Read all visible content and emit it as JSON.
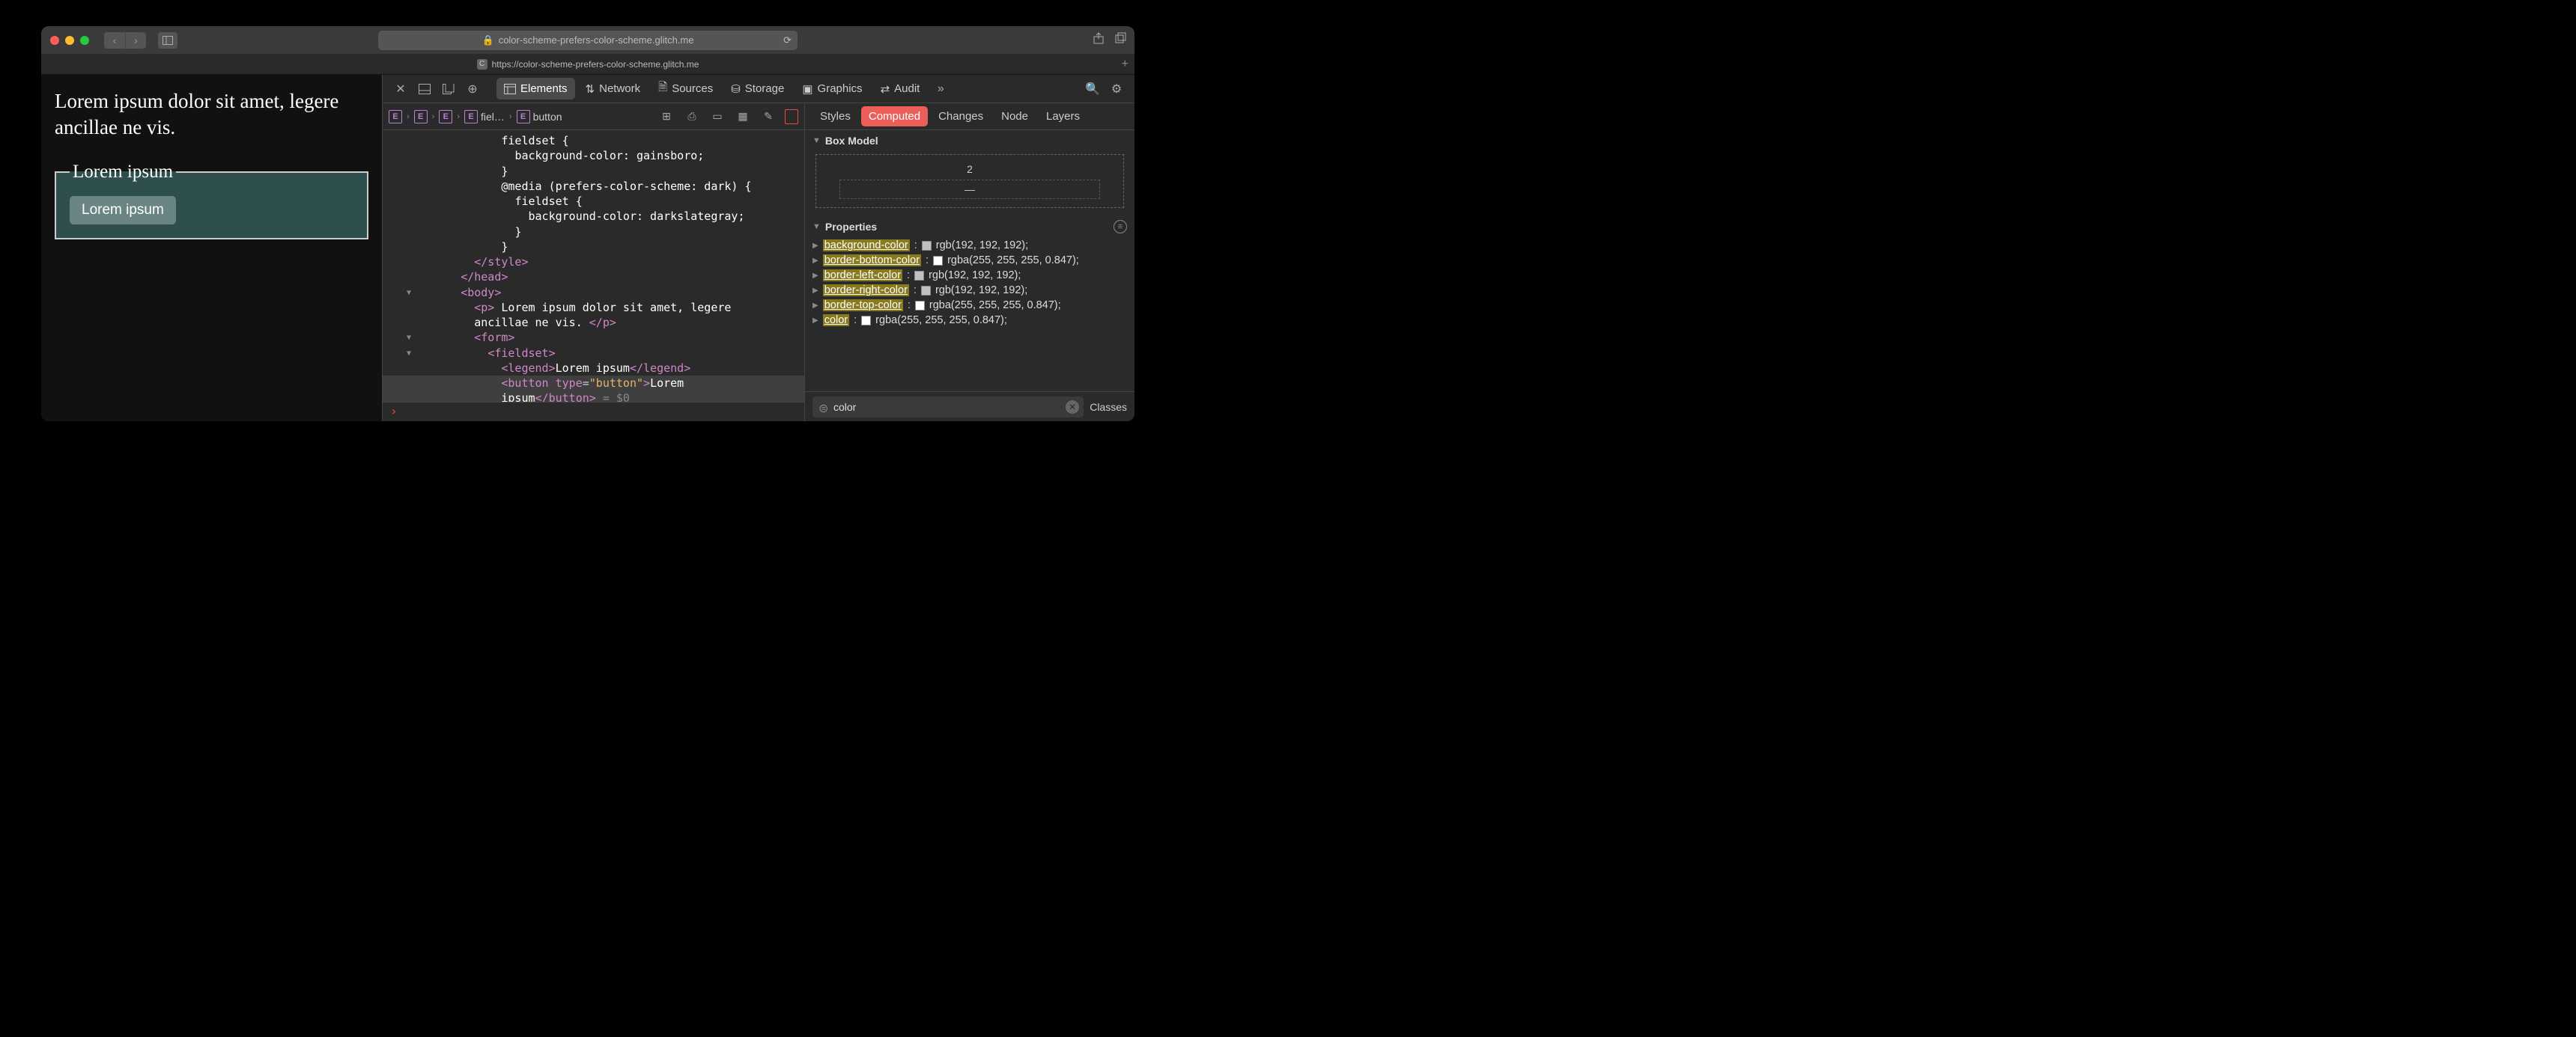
{
  "titlebar": {
    "url_display": "color-scheme-prefers-color-scheme.glitch.me",
    "lock": "🔒"
  },
  "tab": {
    "label": "https://color-scheme-prefers-color-scheme.glitch.me",
    "favicon": "C"
  },
  "page": {
    "paragraph": "Lorem ipsum dolor sit amet, legere ancillae ne vis.",
    "legend": "Lorem ipsum",
    "button": "Lorem ipsum"
  },
  "devtools": {
    "tabs": [
      "Elements",
      "Network",
      "Sources",
      "Storage",
      "Graphics",
      "Audit"
    ],
    "active_tab": "Elements",
    "breadcrumb": [
      {
        "badge": "E",
        "label": ""
      },
      {
        "badge": "E",
        "label": ""
      },
      {
        "badge": "E",
        "label": ""
      },
      {
        "badge": "E",
        "label": "fiel…"
      },
      {
        "badge": "E",
        "label": "button"
      }
    ],
    "source_lines": [
      {
        "indent": 6,
        "text_html": "fieldset {"
      },
      {
        "indent": 7,
        "text_html": "background-color: gainsboro;"
      },
      {
        "indent": 6,
        "text_html": "}"
      },
      {
        "indent": 6,
        "text_html": "@media (prefers-color-scheme: dark) {"
      },
      {
        "indent": 7,
        "text_html": "fieldset {"
      },
      {
        "indent": 8,
        "text_html": "background-color: darkslategray;"
      },
      {
        "indent": 7,
        "text_html": "}"
      },
      {
        "indent": 6,
        "text_html": "}"
      },
      {
        "indent": 4,
        "tag_close": "style"
      },
      {
        "indent": 3,
        "tag_close": "head"
      },
      {
        "indent": 3,
        "arrow": true,
        "tag_open": "body"
      },
      {
        "indent": 4,
        "p_line": true
      },
      {
        "indent": 4,
        "p_cont": true
      },
      {
        "indent": 4,
        "arrow": true,
        "tag_open": "form"
      },
      {
        "indent": 5,
        "arrow": true,
        "tag_open": "fieldset"
      },
      {
        "indent": 6,
        "legend_line": true
      },
      {
        "indent": 6,
        "button_line": true,
        "sel": true
      },
      {
        "indent": 6,
        "button_cont": true,
        "sel": true
      }
    ],
    "p_text1": " Lorem ipsum dolor sit amet, legere",
    "p_text2": "ancillae ne vis. ",
    "legend_text": "Lorem ipsum",
    "button_attr": "button",
    "button_text1": "Lorem",
    "button_text2": "ipsum",
    "dollar": " = $0",
    "console_prompt": "›"
  },
  "styles": {
    "tabs": [
      "Styles",
      "Computed",
      "Changes",
      "Node",
      "Layers"
    ],
    "active": "Computed",
    "box_label": "Box Model",
    "box_top": "2",
    "box_bottom": "—",
    "props_label": "Properties",
    "properties": [
      {
        "name": "background-color",
        "swatch": "#c0c0c0",
        "value": "rgb(192, 192, 192)"
      },
      {
        "name": "border-bottom-color",
        "swatch": "#ffffff",
        "value": "rgba(255, 255, 255, 0.847)"
      },
      {
        "name": "border-left-color",
        "swatch": "#c0c0c0",
        "value": "rgb(192, 192, 192)"
      },
      {
        "name": "border-right-color",
        "swatch": "#c0c0c0",
        "value": "rgb(192, 192, 192)"
      },
      {
        "name": "border-top-color",
        "swatch": "#ffffff",
        "value": "rgba(255, 255, 255, 0.847)"
      },
      {
        "name": "color",
        "swatch": "#ffffff",
        "value": "rgba(255, 255, 255, 0.847)"
      }
    ],
    "filter_value": "color",
    "classes_label": "Classes"
  }
}
